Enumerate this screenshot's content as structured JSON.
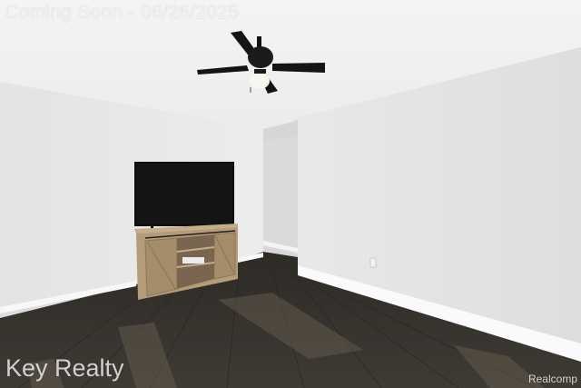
{
  "watermark": {
    "banner": "Coming Soon - 06/26/2025",
    "brand": "Key Realty",
    "credit": "Realcomp"
  },
  "scene": {
    "objects": [
      "ceiling-fan",
      "flat-screen-tv",
      "barn-door-tv-console",
      "wall-outlet",
      "hallway-opening"
    ],
    "palette": {
      "ceiling": "#f1f1f1",
      "wall_left": "#e8e8e8",
      "wall_right": "#e4e4e4",
      "hallway": "#d8d8d8",
      "floor": "#3a3631",
      "baseboard": "#fafafa",
      "tv_screen": "#0d0d0d",
      "console_wood": "#b49c78",
      "fan_blade": "#141414"
    }
  }
}
